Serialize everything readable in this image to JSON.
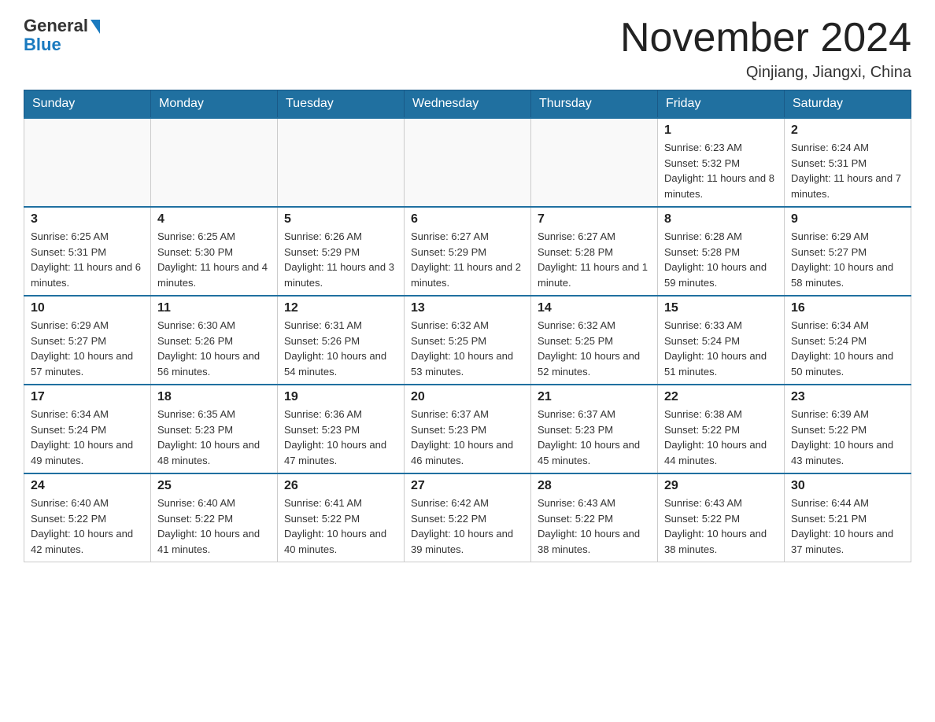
{
  "logo": {
    "general": "General",
    "blue": "Blue"
  },
  "header": {
    "month_year": "November 2024",
    "location": "Qinjiang, Jiangxi, China"
  },
  "weekdays": [
    "Sunday",
    "Monday",
    "Tuesday",
    "Wednesday",
    "Thursday",
    "Friday",
    "Saturday"
  ],
  "weeks": [
    {
      "days": [
        {
          "num": "",
          "info": ""
        },
        {
          "num": "",
          "info": ""
        },
        {
          "num": "",
          "info": ""
        },
        {
          "num": "",
          "info": ""
        },
        {
          "num": "",
          "info": ""
        },
        {
          "num": "1",
          "info": "Sunrise: 6:23 AM\nSunset: 5:32 PM\nDaylight: 11 hours and 8 minutes."
        },
        {
          "num": "2",
          "info": "Sunrise: 6:24 AM\nSunset: 5:31 PM\nDaylight: 11 hours and 7 minutes."
        }
      ]
    },
    {
      "days": [
        {
          "num": "3",
          "info": "Sunrise: 6:25 AM\nSunset: 5:31 PM\nDaylight: 11 hours and 6 minutes."
        },
        {
          "num": "4",
          "info": "Sunrise: 6:25 AM\nSunset: 5:30 PM\nDaylight: 11 hours and 4 minutes."
        },
        {
          "num": "5",
          "info": "Sunrise: 6:26 AM\nSunset: 5:29 PM\nDaylight: 11 hours and 3 minutes."
        },
        {
          "num": "6",
          "info": "Sunrise: 6:27 AM\nSunset: 5:29 PM\nDaylight: 11 hours and 2 minutes."
        },
        {
          "num": "7",
          "info": "Sunrise: 6:27 AM\nSunset: 5:28 PM\nDaylight: 11 hours and 1 minute."
        },
        {
          "num": "8",
          "info": "Sunrise: 6:28 AM\nSunset: 5:28 PM\nDaylight: 10 hours and 59 minutes."
        },
        {
          "num": "9",
          "info": "Sunrise: 6:29 AM\nSunset: 5:27 PM\nDaylight: 10 hours and 58 minutes."
        }
      ]
    },
    {
      "days": [
        {
          "num": "10",
          "info": "Sunrise: 6:29 AM\nSunset: 5:27 PM\nDaylight: 10 hours and 57 minutes."
        },
        {
          "num": "11",
          "info": "Sunrise: 6:30 AM\nSunset: 5:26 PM\nDaylight: 10 hours and 56 minutes."
        },
        {
          "num": "12",
          "info": "Sunrise: 6:31 AM\nSunset: 5:26 PM\nDaylight: 10 hours and 54 minutes."
        },
        {
          "num": "13",
          "info": "Sunrise: 6:32 AM\nSunset: 5:25 PM\nDaylight: 10 hours and 53 minutes."
        },
        {
          "num": "14",
          "info": "Sunrise: 6:32 AM\nSunset: 5:25 PM\nDaylight: 10 hours and 52 minutes."
        },
        {
          "num": "15",
          "info": "Sunrise: 6:33 AM\nSunset: 5:24 PM\nDaylight: 10 hours and 51 minutes."
        },
        {
          "num": "16",
          "info": "Sunrise: 6:34 AM\nSunset: 5:24 PM\nDaylight: 10 hours and 50 minutes."
        }
      ]
    },
    {
      "days": [
        {
          "num": "17",
          "info": "Sunrise: 6:34 AM\nSunset: 5:24 PM\nDaylight: 10 hours and 49 minutes."
        },
        {
          "num": "18",
          "info": "Sunrise: 6:35 AM\nSunset: 5:23 PM\nDaylight: 10 hours and 48 minutes."
        },
        {
          "num": "19",
          "info": "Sunrise: 6:36 AM\nSunset: 5:23 PM\nDaylight: 10 hours and 47 minutes."
        },
        {
          "num": "20",
          "info": "Sunrise: 6:37 AM\nSunset: 5:23 PM\nDaylight: 10 hours and 46 minutes."
        },
        {
          "num": "21",
          "info": "Sunrise: 6:37 AM\nSunset: 5:23 PM\nDaylight: 10 hours and 45 minutes."
        },
        {
          "num": "22",
          "info": "Sunrise: 6:38 AM\nSunset: 5:22 PM\nDaylight: 10 hours and 44 minutes."
        },
        {
          "num": "23",
          "info": "Sunrise: 6:39 AM\nSunset: 5:22 PM\nDaylight: 10 hours and 43 minutes."
        }
      ]
    },
    {
      "days": [
        {
          "num": "24",
          "info": "Sunrise: 6:40 AM\nSunset: 5:22 PM\nDaylight: 10 hours and 42 minutes."
        },
        {
          "num": "25",
          "info": "Sunrise: 6:40 AM\nSunset: 5:22 PM\nDaylight: 10 hours and 41 minutes."
        },
        {
          "num": "26",
          "info": "Sunrise: 6:41 AM\nSunset: 5:22 PM\nDaylight: 10 hours and 40 minutes."
        },
        {
          "num": "27",
          "info": "Sunrise: 6:42 AM\nSunset: 5:22 PM\nDaylight: 10 hours and 39 minutes."
        },
        {
          "num": "28",
          "info": "Sunrise: 6:43 AM\nSunset: 5:22 PM\nDaylight: 10 hours and 38 minutes."
        },
        {
          "num": "29",
          "info": "Sunrise: 6:43 AM\nSunset: 5:22 PM\nDaylight: 10 hours and 38 minutes."
        },
        {
          "num": "30",
          "info": "Sunrise: 6:44 AM\nSunset: 5:21 PM\nDaylight: 10 hours and 37 minutes."
        }
      ]
    }
  ]
}
